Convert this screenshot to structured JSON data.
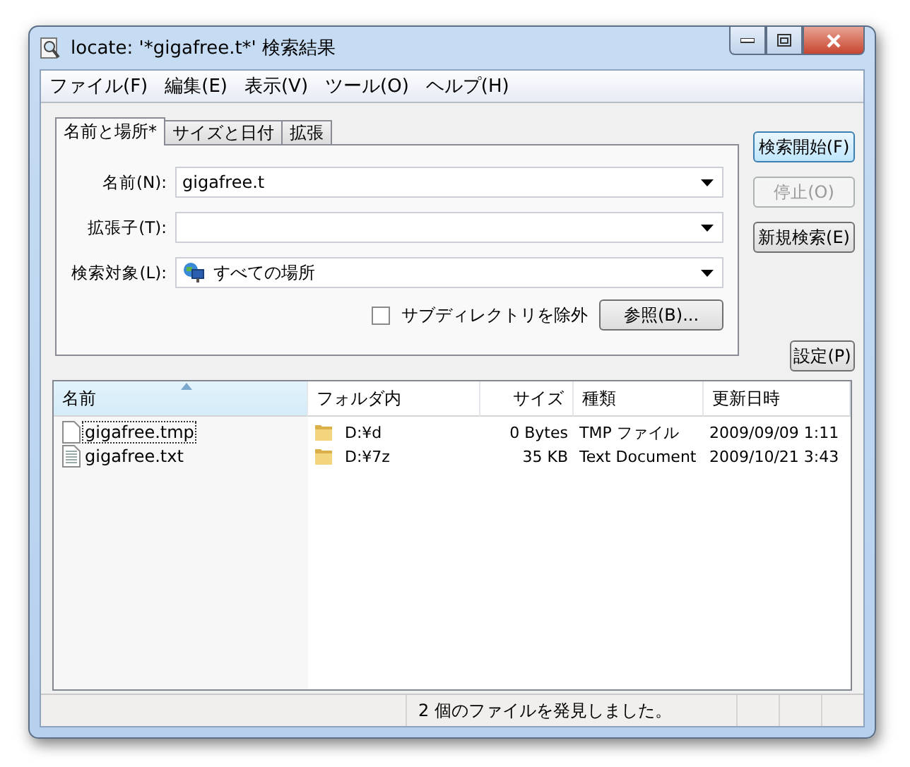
{
  "window": {
    "title": "locate: '*gigafree.t*' 検索結果"
  },
  "menu": [
    "ファイル(F)",
    "編集(E)",
    "表示(V)",
    "ツール(O)",
    "ヘルプ(H)"
  ],
  "tabs": [
    {
      "label": "名前と場所*",
      "selected": true
    },
    {
      "label": "サイズと日付",
      "selected": false
    },
    {
      "label": "拡張",
      "selected": false
    }
  ],
  "fields": [
    {
      "label": "名前(N):",
      "value": "gigafree.t",
      "kind": "text"
    },
    {
      "label": "拡張子(T):",
      "kind": "text"
    },
    {
      "label": "検索対象(L):",
      "value": "すべての場所",
      "kind": "location"
    }
  ],
  "exclude_subdirs": {
    "label": "サブディレクトリを除外",
    "checked": false
  },
  "browse_button": "参照(B)...",
  "side_buttons": [
    {
      "label": "検索開始(F)",
      "disabled": false,
      "default": true
    },
    {
      "label": "停止(O)",
      "disabled": true,
      "default": false
    },
    {
      "label": "新規検索(E)",
      "disabled": false,
      "default": false
    }
  ],
  "settings_button": "設定(P)",
  "columns": [
    {
      "label": "名前",
      "sorted": true
    },
    {
      "label": "フォルダ内",
      "sorted": false
    },
    {
      "label": "サイズ",
      "sorted": false
    },
    {
      "label": "種類",
      "sorted": false
    },
    {
      "label": "更新日時",
      "sorted": false
    }
  ],
  "rows": [
    {
      "kind": "blank",
      "name": "gigafree.tmp",
      "focused": true,
      "folder": "D:¥d",
      "size": "0 Bytes",
      "type": "TMP ファイル",
      "modified": "2009/09/09 1:11"
    },
    {
      "kind": "text",
      "name": "gigafree.txt",
      "focused": false,
      "folder": "D:¥7z",
      "size": "35 KB",
      "type": "Text Document",
      "modified": "2009/10/21 3:43"
    }
  ],
  "status_bar": "2 個のファイルを発見しました。"
}
